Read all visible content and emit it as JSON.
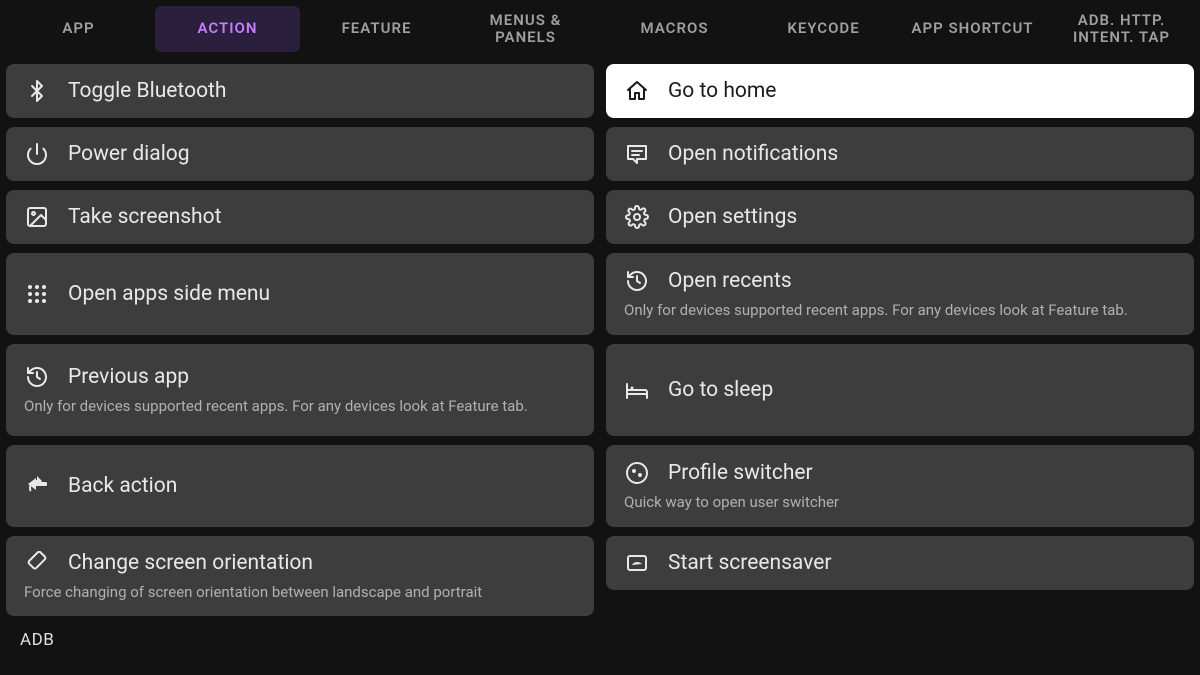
{
  "tabs": [
    {
      "label": "APP"
    },
    {
      "label": "ACTION",
      "active": true
    },
    {
      "label": "FEATURE"
    },
    {
      "label": "MENUS & PANELS"
    },
    {
      "label": "MACROS"
    },
    {
      "label": "KEYCODE"
    },
    {
      "label": "APP SHORTCUT"
    },
    {
      "label": "ADB. HTTP. INTENT. TAP"
    }
  ],
  "left": {
    "0": {
      "title": "Toggle Bluetooth"
    },
    "1": {
      "title": "Power dialog"
    },
    "2": {
      "title": "Take screenshot"
    },
    "3": {
      "title": "Open apps side menu"
    },
    "4": {
      "title": "Previous app",
      "sub": "Only for devices supported recent apps. For any devices look at Feature tab."
    },
    "5": {
      "title": "Back action"
    },
    "6": {
      "title": "Change screen orientation",
      "sub": "Force changing of screen orientation between landscape and portrait"
    }
  },
  "right": {
    "0": {
      "title": "Go to home"
    },
    "1": {
      "title": "Open notifications"
    },
    "2": {
      "title": "Open settings"
    },
    "3": {
      "title": "Open recents",
      "sub": "Only for devices supported recent apps. For any devices look at Feature tab."
    },
    "4": {
      "title": "Go to sleep"
    },
    "5": {
      "title": "Profile switcher",
      "sub": "Quick way to open user switcher"
    },
    "6": {
      "title": "Start screensaver"
    }
  },
  "section": "ADB"
}
